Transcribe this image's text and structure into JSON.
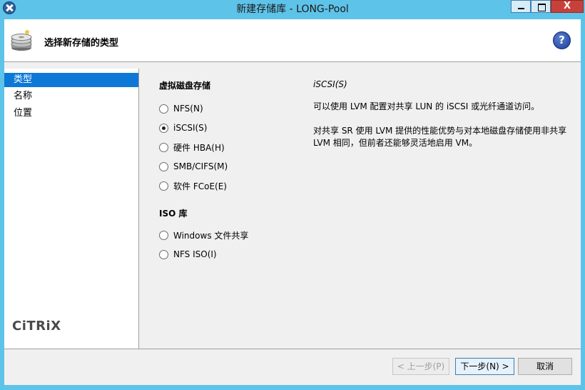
{
  "window": {
    "title": "新建存储库 - LONG-Pool",
    "close_glyph": "X"
  },
  "header": {
    "title": "选择新存储的类型",
    "help_glyph": "?"
  },
  "nav": {
    "items": [
      {
        "label": "类型",
        "selected": true
      },
      {
        "label": "名称",
        "selected": false
      },
      {
        "label": "位置",
        "selected": false
      }
    ],
    "logo_text": "CiTRiX"
  },
  "content": {
    "vdisk_section": "虚拟磁盘存储",
    "vdisk_options": [
      {
        "label": "NFS(N)",
        "checked": false
      },
      {
        "label": "iSCSI(S)",
        "checked": true
      },
      {
        "label": "硬件 HBA(H)",
        "checked": false
      },
      {
        "label": "SMB/CIFS(M)",
        "checked": false
      },
      {
        "label": "软件 FCoE(E)",
        "checked": false
      }
    ],
    "iso_section": "ISO 库",
    "iso_options": [
      {
        "label": "Windows 文件共享",
        "checked": false
      },
      {
        "label": "NFS ISO(I)",
        "checked": false
      }
    ]
  },
  "description": {
    "title": "iSCSI(S)",
    "p1": "可以使用 LVM 配置对共享 LUN 的 iSCSI 或光纤通道访问。",
    "p2": "对共享 SR 使用 LVM 提供的性能优势与对本地磁盘存储使用非共享 LVM 相同，但前者还能够灵活地启用 VM。"
  },
  "footer": {
    "prev_label": "< 上一步(P)",
    "next_label": "下一步(N) >",
    "cancel_label": "取消"
  },
  "colors": {
    "title_bar": "#5ec3e8",
    "selection": "#0e78d7",
    "close_button": "#c7413b"
  }
}
